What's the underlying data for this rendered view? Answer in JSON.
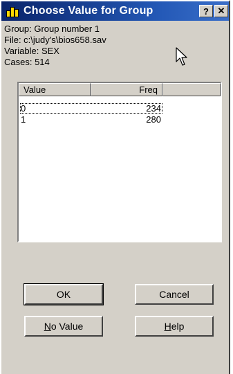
{
  "window": {
    "title": "Choose Value for Group"
  },
  "titlebar": {
    "help_glyph": "?",
    "close_glyph": "✕"
  },
  "info": {
    "group": "Group: Group number 1",
    "file": "File: c:\\judy's\\bios658.sav",
    "variable": "Variable: SEX",
    "cases": "Cases:  514"
  },
  "table": {
    "columns": [
      "Value",
      "Freq",
      ""
    ],
    "rows": [
      {
        "value": "0",
        "freq": "234",
        "selected": true
      },
      {
        "value": "1",
        "freq": "280",
        "selected": false
      }
    ]
  },
  "buttons": {
    "ok": "OK",
    "cancel": "Cancel",
    "no_value_mnemonic": "N",
    "no_value_rest": "o Value",
    "help_mnemonic": "H",
    "help_rest": "elp"
  },
  "icons": {
    "app": "bar-chart-icon",
    "cursor": "mouse-pointer-icon"
  }
}
